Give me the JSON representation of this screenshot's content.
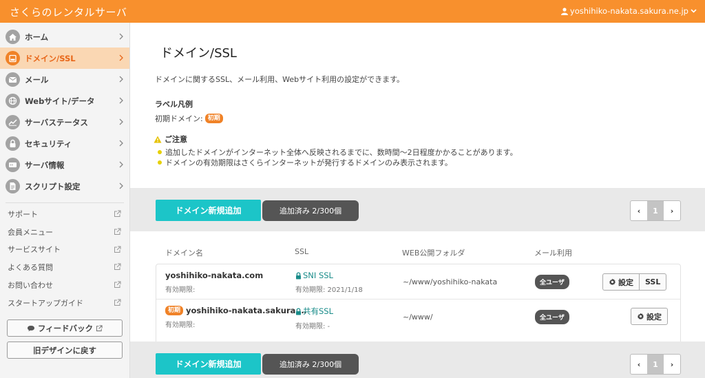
{
  "header": {
    "brand": "さくらのレンタルサーバ",
    "user": "yoshihiko-nakata.sakura.ne.jp"
  },
  "sidebar": {
    "items": [
      {
        "label": "ホーム",
        "icon": "home-icon"
      },
      {
        "label": "ドメイン/SSL",
        "icon": "domain-icon",
        "active": true
      },
      {
        "label": "メール",
        "icon": "mail-icon"
      },
      {
        "label": "Webサイト/データ",
        "icon": "globe-icon"
      },
      {
        "label": "サーバステータス",
        "icon": "chart-icon"
      },
      {
        "label": "セキュリティ",
        "icon": "lock-icon"
      },
      {
        "label": "サーバ情報",
        "icon": "server-icon"
      },
      {
        "label": "スクリプト設定",
        "icon": "script-icon"
      }
    ],
    "links": [
      "サポート",
      "会員メニュー",
      "サービスサイト",
      "よくある質問",
      "お問い合わせ",
      "スタートアップガイド"
    ],
    "feedback": "フィードバック",
    "old_design": "旧デザインに戻す"
  },
  "main": {
    "title": "ドメイン/SSL",
    "description": "ドメインに関するSSL、メール利用、Webサイト利用の設定ができます。",
    "legend_heading": "ラベル凡例",
    "legend_text": "初期ドメイン:",
    "tag_initial": "初期",
    "caution_heading": "ご注意",
    "caution_items": [
      "追加したドメインがインターネット全体へ反映されるまでに、数時間〜2日程度かかることがあります。",
      "ドメインの有効期限はさくらインターネットが発行するドメインのみ表示されます。"
    ],
    "add_button": "ドメイン新規追加",
    "count_label": "追加済み 2/300個",
    "pager": {
      "prev": "‹",
      "page": "1",
      "next": "›"
    },
    "columns": [
      "ドメイン名",
      "SSL",
      "WEB公開フォルダ",
      "メール利用"
    ],
    "rows": [
      {
        "domain": "yoshihiko-nakata.com",
        "expiry_label": "有効期限:",
        "ssl": "SNI SSL",
        "ssl_expiry": "有効期限: 2021/1/18",
        "folder": "~/www/yoshihiko-nakata",
        "mail": "全ユーザ",
        "settings": "設定",
        "ssl_button": "SSL"
      },
      {
        "domain": "yoshihiko-nakata.sakura.…",
        "initial": true,
        "expiry_label": "有効期限:",
        "ssl": "共有SSL",
        "ssl_expiry": "有効期限: -",
        "folder": "~/www/",
        "mail": "全ユーザ",
        "settings": "設定"
      }
    ]
  },
  "colors": {
    "brand_orange": "#f8902d",
    "accent_teal": "#1cc5c8",
    "active_bg": "#fad7b3"
  }
}
